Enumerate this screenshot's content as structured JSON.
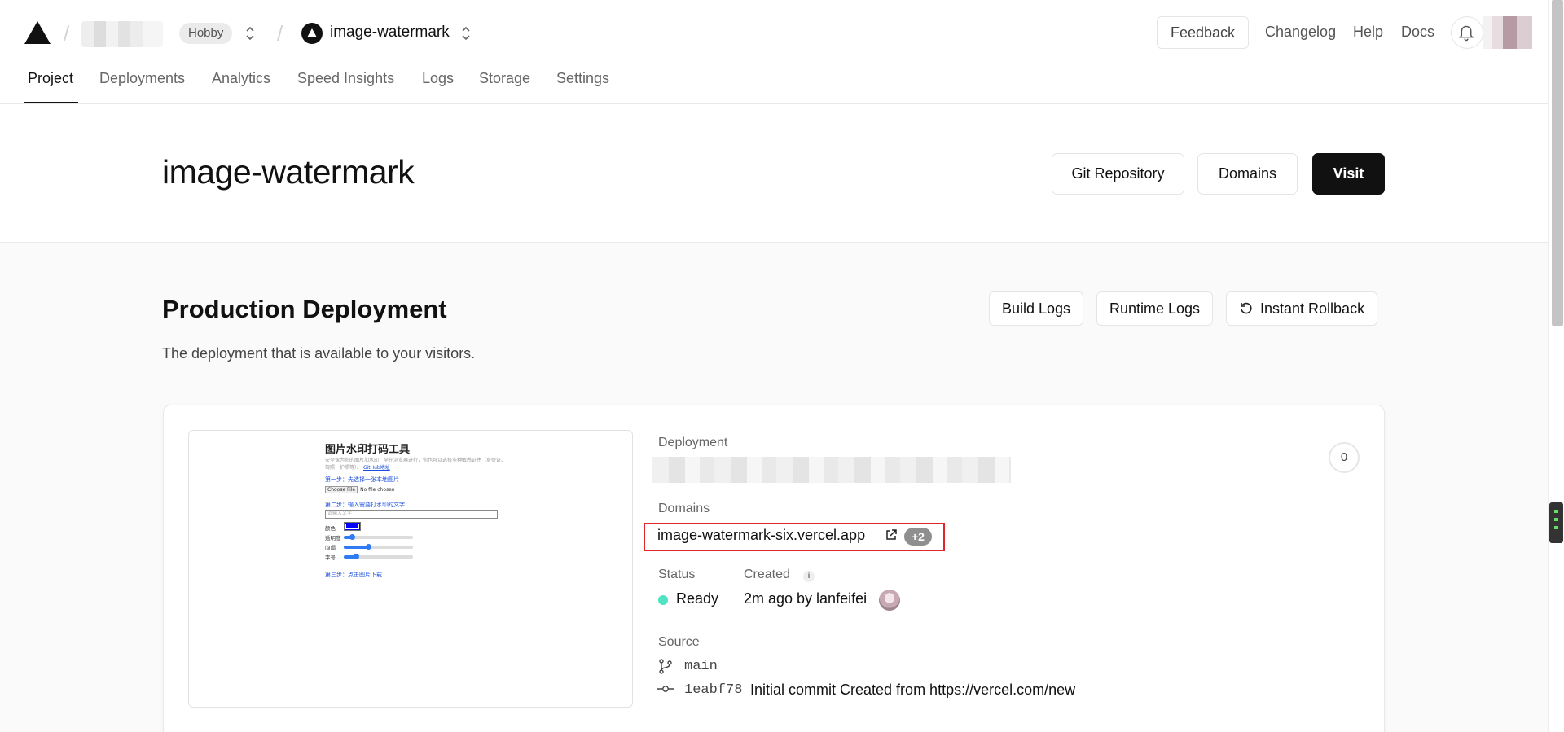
{
  "header": {
    "team_badge": "Hobby",
    "project_name": "image-watermark",
    "feedback_label": "Feedback",
    "links": [
      "Changelog",
      "Help",
      "Docs"
    ]
  },
  "tabs": [
    "Project",
    "Deployments",
    "Analytics",
    "Speed Insights",
    "Logs",
    "Storage",
    "Settings"
  ],
  "title_band": {
    "title": "image-watermark",
    "git_repo_label": "Git Repository",
    "domains_label": "Domains",
    "visit_label": "Visit"
  },
  "production": {
    "title": "Production Deployment",
    "subtitle": "The deployment that is available to your visitors.",
    "build_logs_label": "Build Logs",
    "runtime_logs_label": "Runtime Logs",
    "rollback_label": "Instant Rollback"
  },
  "preview": {
    "title": "图片水印打码工具",
    "desc_line1": "安全保为你的图片加水印，全在浏览器进行，你也可以选择多种敏感证件（身份证、",
    "desc_line2": "驾照，护照等）。",
    "github_link": "GitHub地址",
    "step1": "第一步：先选择一张本地图片",
    "choose_file": "Choose File",
    "no_file": "No file chosen",
    "step2": "第二步：输入需要打水印的文字",
    "input_placeholder": "请输入文字",
    "label_color": "颜色",
    "label_opacity": "透明度",
    "label_spacing": "间隔",
    "label_size": "字号",
    "opacity_level": 0.12,
    "spacing_level": 0.35,
    "size_level": 0.18,
    "step3": "第三步：点击图片下载"
  },
  "deployment": {
    "deployment_label": "Deployment",
    "domains_label": "Domains",
    "domain": "image-watermark-six.vercel.app",
    "extra_domains": "+2",
    "status_label": "Status",
    "status_value": "Ready",
    "created_label": "Created",
    "created_value": "2m ago by lanfeifei",
    "source_label": "Source",
    "branch": "main",
    "commit_hash": "1eabf78",
    "commit_message": "Initial commit Created from https://vercel.com/new",
    "count": "0"
  },
  "colors": {
    "accent_dark": "#111111",
    "ready_dot": "#50e3c2",
    "highlight_box": "#e0262c"
  }
}
